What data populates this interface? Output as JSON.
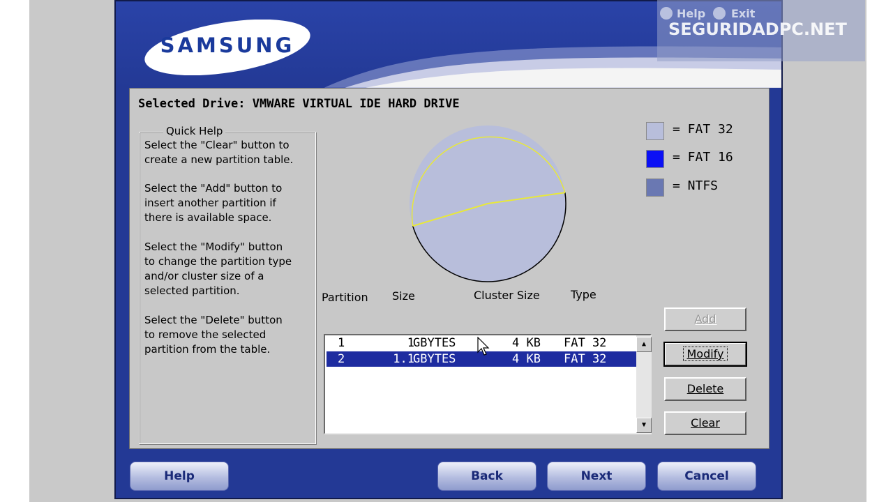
{
  "header": {
    "logo_text": "SAMSUNG"
  },
  "watermark": {
    "text": "SEGURIDADPC.NET",
    "help_label": "Help",
    "exit_label": "Exit"
  },
  "drive": {
    "label": "Selected Drive: VMWARE VIRTUAL IDE HARD DRIVE"
  },
  "quick_help": {
    "title": "Quick Help",
    "paragraphs": [
      "Select the \"Clear\" button to\ncreate a new partition table.",
      "Select the \"Add\" button to\ninsert another partition if\nthere is available space.",
      "Select the \"Modify\" button\nto change the partition type\nand/or cluster size of a\nselected partition.",
      "Select the \"Delete\" button\nto remove the selected\npartition from the table."
    ]
  },
  "legend": [
    {
      "label": "= FAT 32",
      "color": "#b8bedb"
    },
    {
      "label": "= FAT 16",
      "color": "#0b10f5"
    },
    {
      "label": "= NTFS",
      "color": "#6a78b2"
    }
  ],
  "chart_data": {
    "type": "pie",
    "categories": [
      "1",
      "2"
    ],
    "values": [
      1,
      1.1
    ],
    "units": "GBYTES",
    "colors": [
      "#b8bedb",
      "#b8bedb"
    ],
    "outline_color": "#000000",
    "divider_color": "#e8e83a"
  },
  "table": {
    "columns": [
      "Partition",
      "Size",
      "Cluster Size",
      "Type"
    ],
    "rows": [
      {
        "num": "1",
        "size": "1",
        "unit": "GBYTES",
        "cluster": "4 KB",
        "type": "FAT 32",
        "selected": false
      },
      {
        "num": "2",
        "size": "1.1",
        "unit": "GBYTES",
        "cluster": "4 KB",
        "type": "FAT 32",
        "selected": true
      }
    ]
  },
  "buttons": {
    "add": "Add",
    "modify": "Modify",
    "delete": "Delete",
    "clear": "Clear"
  },
  "nav": {
    "help": "Help",
    "back": "Back",
    "next": "Next",
    "cancel": "Cancel"
  },
  "colors": {
    "frame_blue": "#233995",
    "panel_gray": "#c8c8c8",
    "selection_blue": "#1e2ca0"
  }
}
